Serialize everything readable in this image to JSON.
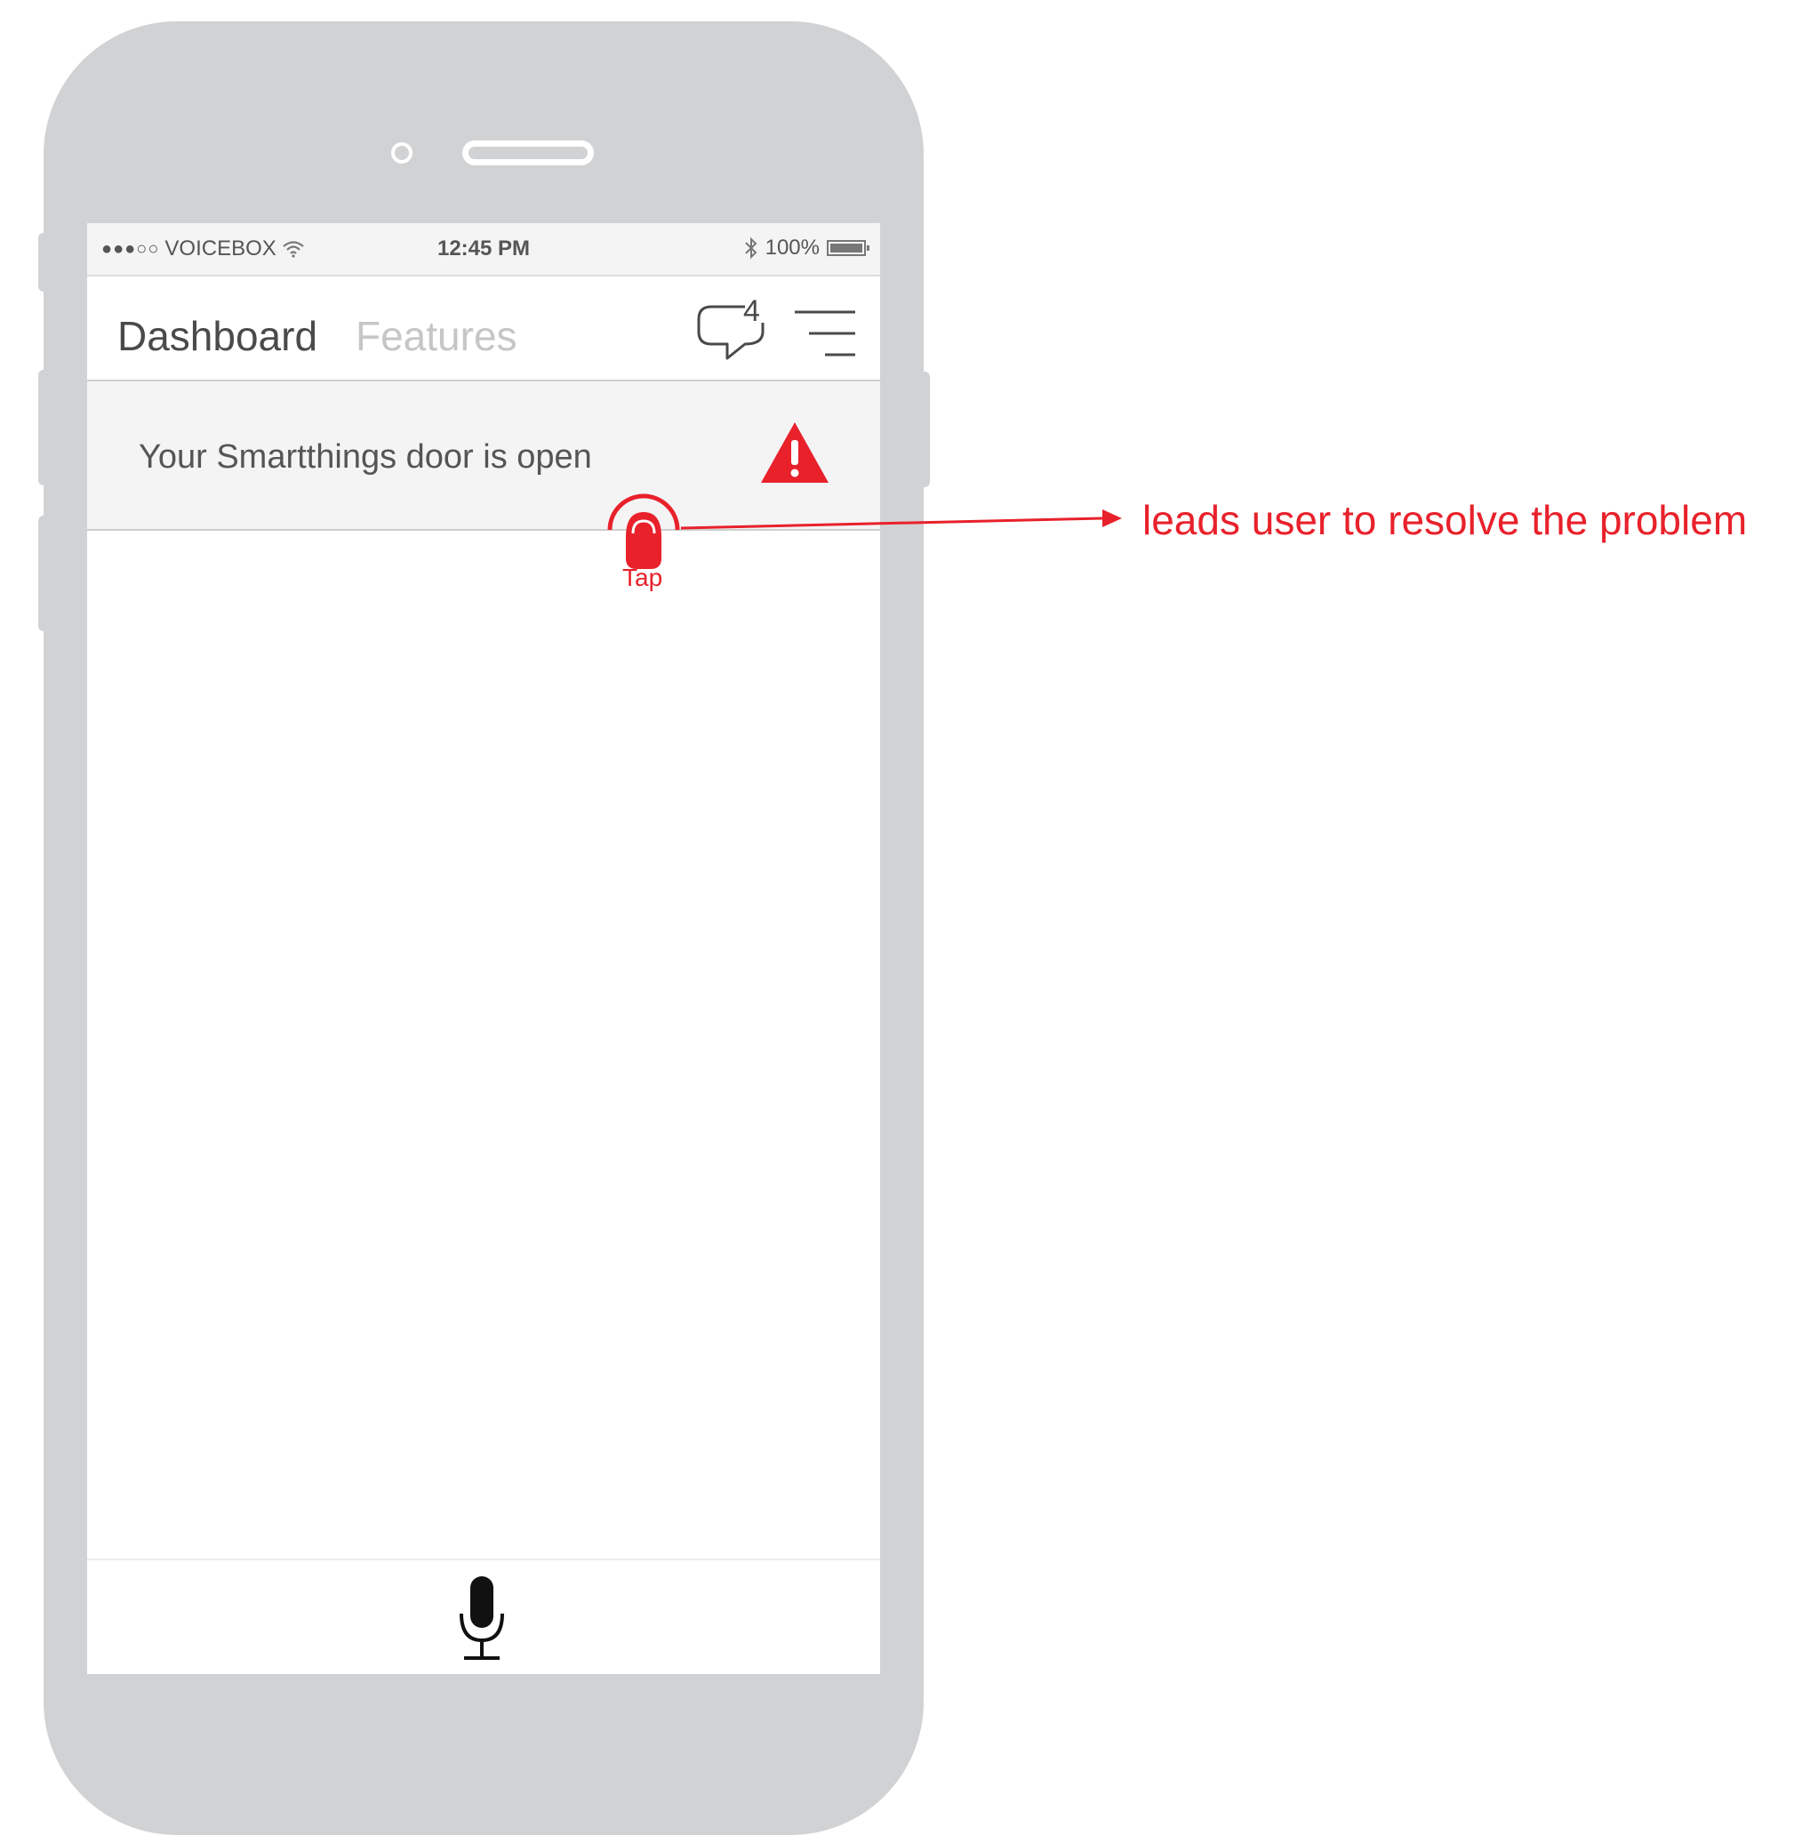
{
  "status_bar": {
    "signal": "●●●○○",
    "carrier": "VOICEBOX",
    "time": "12:45 PM",
    "battery_percent": "100%",
    "icons": [
      "wifi-icon",
      "bluetooth-icon",
      "battery-icon"
    ]
  },
  "nav": {
    "tabs": [
      {
        "label": "Dashboard",
        "active": true
      },
      {
        "label": "Features",
        "active": false
      }
    ],
    "messages_count": "4"
  },
  "alert": {
    "message": "Your Smartthings door is open",
    "icon": "warning-icon"
  },
  "gesture": {
    "label": "Tap",
    "icon": "tap-gesture-icon"
  },
  "annotation": {
    "text": "leads user to resolve the problem"
  },
  "footer": {
    "icon": "microphone-icon"
  },
  "colors": {
    "accent": "#e8212b",
    "phone_body": "#d1d2d4",
    "panel": "#f4f4f5"
  }
}
